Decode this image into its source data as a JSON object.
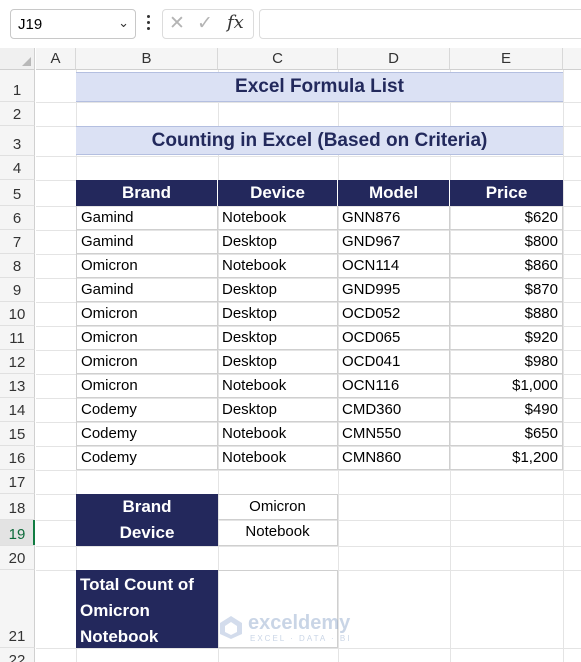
{
  "formula_bar": {
    "name_box": "J19",
    "cancel_icon": "close-icon",
    "enter_icon": "check-icon",
    "function_label": "fx",
    "formula": ""
  },
  "columns": [
    "A",
    "B",
    "C",
    "D",
    "E"
  ],
  "rows": [
    "1",
    "2",
    "3",
    "4",
    "5",
    "6",
    "7",
    "8",
    "9",
    "10",
    "11",
    "12",
    "13",
    "14",
    "15",
    "16",
    "17",
    "18",
    "19",
    "20",
    "21",
    "22"
  ],
  "active_row": "19",
  "title": "Excel Formula List",
  "subtitle": "Counting in Excel (Based on Criteria)",
  "table": {
    "headers": [
      "Brand",
      "Device",
      "Model",
      "Price"
    ],
    "rows": [
      [
        "Gamind",
        "Notebook",
        "GNN876",
        "$620"
      ],
      [
        "Gamind",
        "Desktop",
        "GND967",
        "$800"
      ],
      [
        "Omicron",
        "Notebook",
        "OCN114",
        "$860"
      ],
      [
        "Gamind",
        "Desktop",
        "GND995",
        "$870"
      ],
      [
        "Omicron",
        "Desktop",
        "OCD052",
        "$880"
      ],
      [
        "Omicron",
        "Desktop",
        "OCD065",
        "$920"
      ],
      [
        "Omicron",
        "Desktop",
        "OCD041",
        "$980"
      ],
      [
        "Omicron",
        "Notebook",
        "OCN116",
        "$1,000"
      ],
      [
        "Codemy",
        "Desktop",
        "CMD360",
        "$490"
      ],
      [
        "Codemy",
        "Notebook",
        "CMN550",
        "$650"
      ],
      [
        "Codemy",
        "Notebook",
        "CMN860",
        "$1,200"
      ]
    ]
  },
  "criteria": [
    {
      "label": "Brand",
      "value": "Omicron"
    },
    {
      "label": "Device",
      "value": "Notebook"
    }
  ],
  "total": {
    "label_lines": [
      "Total Count of",
      "Omicron",
      "Notebook"
    ],
    "value": ""
  },
  "watermark": {
    "name": "exceldemy",
    "tagline": "EXCEL · DATA · BI"
  },
  "colors": {
    "header_fill": "#23285c",
    "title_fill": "#dbe1f4",
    "title_text": "#22295c",
    "active_row_marker": "#107c41"
  }
}
